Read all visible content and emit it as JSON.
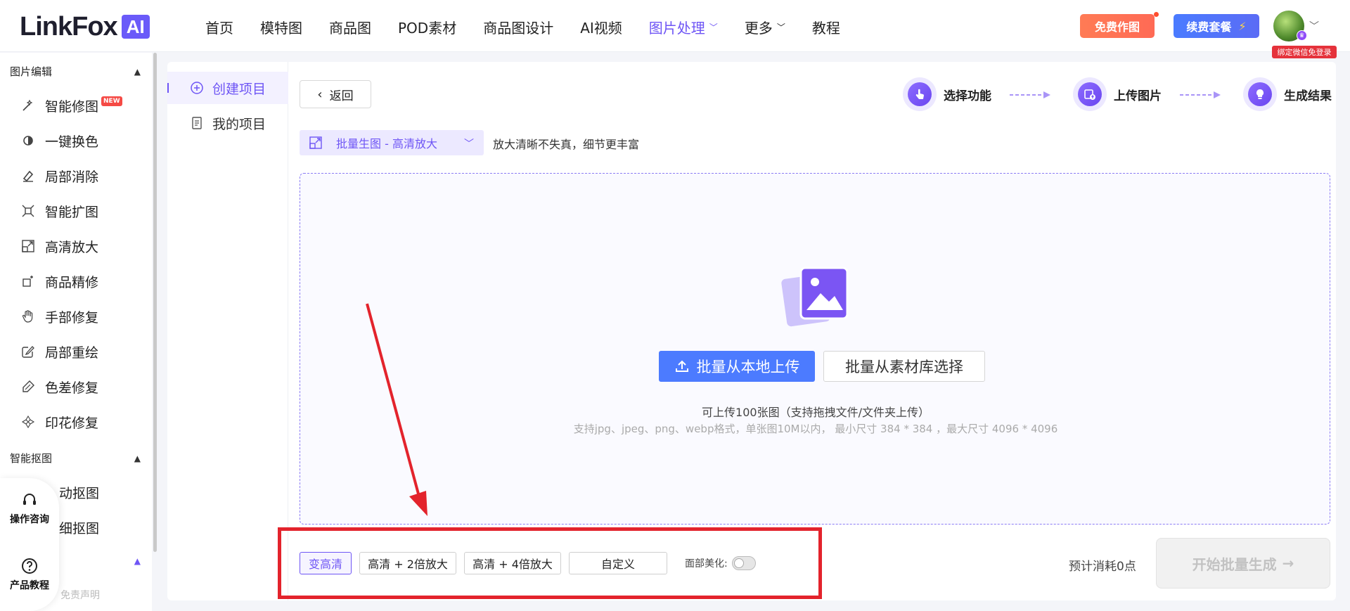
{
  "topbar": {
    "logo_text": "LinkFox",
    "logo_ai": "AI",
    "nav": [
      {
        "label": "首页"
      },
      {
        "label": "模特图"
      },
      {
        "label": "商品图"
      },
      {
        "label": "POD素材"
      },
      {
        "label": "商品图设计"
      },
      {
        "label": "AI视频"
      },
      {
        "label": "图片处理",
        "active": true,
        "has_dropdown": true
      },
      {
        "label": "更多",
        "has_dropdown": true
      },
      {
        "label": "教程"
      }
    ],
    "free_button": "免费作图",
    "renew_button": "续费套餐",
    "renew_icon": "⚡",
    "wechat_tag": "绑定微信免登录"
  },
  "sidebar": {
    "groups": [
      {
        "title": "图片编辑",
        "items": [
          {
            "label": "智能修图",
            "icon": "magic-wand-icon",
            "badge": "NEW"
          },
          {
            "label": "一键换色",
            "icon": "color-swap-icon"
          },
          {
            "label": "局部消除",
            "icon": "eraser-icon"
          },
          {
            "label": "智能扩图",
            "icon": "expand-icon"
          },
          {
            "label": "高清放大",
            "icon": "upscale-icon"
          },
          {
            "label": "商品精修",
            "icon": "retouch-icon"
          },
          {
            "label": "手部修复",
            "icon": "hand-icon"
          },
          {
            "label": "局部重绘",
            "icon": "redraw-icon"
          },
          {
            "label": "色差修复",
            "icon": "color-fix-icon"
          },
          {
            "label": "印花修复",
            "icon": "print-fix-icon"
          }
        ]
      },
      {
        "title": "智能抠图",
        "items": [
          {
            "label": "动抠图"
          },
          {
            "label": "细抠图"
          }
        ]
      }
    ],
    "float": {
      "consult": "操作咨询",
      "tutorial": "产品教程"
    },
    "disclaimer": "免责声明"
  },
  "project_menu": {
    "create": "创建项目",
    "mine": "我的项目"
  },
  "main": {
    "back": "返回",
    "steps": [
      {
        "label": "选择功能",
        "icon": "pointer-hand-icon"
      },
      {
        "label": "上传图片",
        "icon": "upload-image-icon"
      },
      {
        "label": "生成结果",
        "icon": "bulb-icon"
      }
    ],
    "mode_select": "批量生图 - 高清放大",
    "mode_desc": "放大清晰不失真，细节更丰富",
    "upload_local": "批量从本地上传",
    "upload_library": "批量从素材库选择",
    "hint_primary": "可上传100张图（支持拖拽文件/文件夹上传）",
    "hint_secondary": "支持jpg、jpeg、png、webp格式，单张图10M以内， 最小尺寸 384 * 384 ，最大尺寸 4096 * 4096",
    "options": [
      {
        "label": "变高清",
        "active": true
      },
      {
        "label": "高清 + 2倍放大"
      },
      {
        "label": "高清 + 4倍放大"
      },
      {
        "label": "自定义"
      }
    ],
    "face_beauty_label": "面部美化:",
    "face_beauty_on": false,
    "cost": "预计消耗0点",
    "start": "开始批量生成"
  },
  "colors": {
    "accent": "#6e55f5",
    "upload_blue": "#4c7bff",
    "annotation_red": "#e3232c"
  }
}
